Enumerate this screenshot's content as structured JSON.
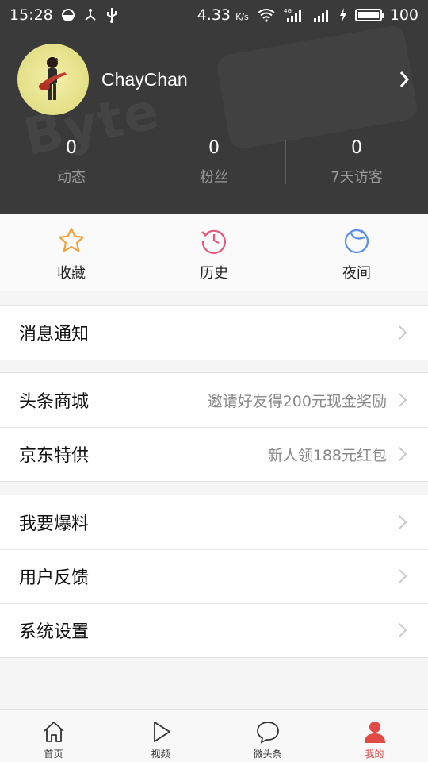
{
  "status_bar": {
    "time": "15:28",
    "network_speed": "4.33",
    "network_speed_unit": "K/s",
    "battery": "100",
    "battery_level": 1.0
  },
  "profile": {
    "username": "ChayChan"
  },
  "stats": [
    {
      "value": "0",
      "label": "动态"
    },
    {
      "value": "0",
      "label": "粉丝"
    },
    {
      "value": "0",
      "label": "7天访客"
    }
  ],
  "quick_actions": [
    {
      "label": "收藏",
      "icon": "star-icon",
      "color": "#f0a43a"
    },
    {
      "label": "历史",
      "icon": "history-clock-icon",
      "color": "#e8587b"
    },
    {
      "label": "夜间",
      "icon": "moon-icon",
      "color": "#5b8ee8"
    }
  ],
  "menu": {
    "notifications": {
      "label": "消息通知"
    },
    "mall": {
      "label": "头条商城",
      "value": "邀请好友得200元现金奖励"
    },
    "jd": {
      "label": "京东特供",
      "value": "新人领188元红包"
    },
    "report": {
      "label": "我要爆料"
    },
    "feedback": {
      "label": "用户反馈"
    },
    "settings": {
      "label": "系统设置"
    }
  },
  "tabbar": [
    {
      "label": "首页",
      "icon": "home-icon",
      "active": false
    },
    {
      "label": "视频",
      "icon": "play-icon",
      "active": false
    },
    {
      "label": "微头条",
      "icon": "chat-bubble-icon",
      "active": false
    },
    {
      "label": "我的",
      "icon": "user-icon",
      "active": true
    }
  ],
  "colors": {
    "accent": "#e24a46",
    "header_bg": "#3a3a3a"
  }
}
